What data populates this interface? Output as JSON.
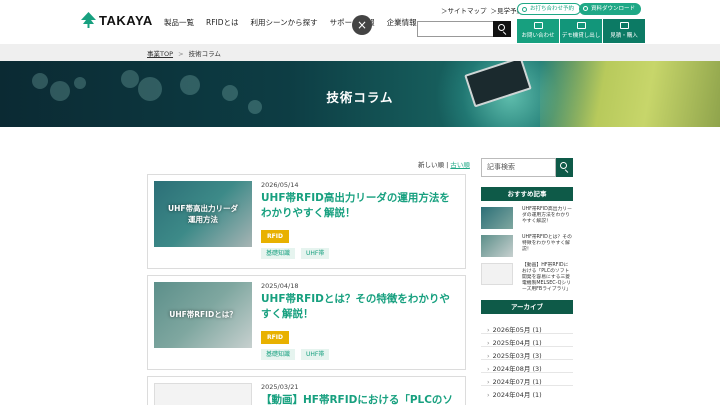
{
  "header": {
    "logo_text": "TAKAYA",
    "nav": [
      "製品一覧",
      "RFIDとは",
      "利用シーンから探す",
      "サポート情報",
      "企業情報"
    ],
    "close_symbol": "×",
    "utility_links": [
      "＞サイトマップ",
      "＞見学予約"
    ],
    "pill_contact": "お打ち合わせ予約",
    "pill_download": "資料ダウンロード",
    "search_placeholder": "",
    "cta": [
      "お問い合わせ",
      "デモ機貸し出し",
      "見積・購入"
    ]
  },
  "breadcrumb": {
    "home": "事業TOP",
    "separator": ">",
    "current": "技術コラム"
  },
  "hero": {
    "title": "技術コラム"
  },
  "sort": {
    "newest": "新しい順",
    "divider": "|",
    "oldest": "古い順"
  },
  "articles": [
    {
      "date": "2026/05/14",
      "title": "UHF帯RFID高出力リーダの運用方法をわかりやすく解説！",
      "thumb_text": "UHF帯高出力リーダ\n運用方法",
      "category": "RFID",
      "tags": [
        "基礎知識",
        "UHF帯"
      ]
    },
    {
      "date": "2025/04/18",
      "title": "UHF帯RFIDとは？その特徴をわかりやすく解説！",
      "thumb_text": "UHF帯RFIDとは？",
      "category": "RFID",
      "tags": [
        "基礎知識",
        "UHF帯"
      ]
    },
    {
      "date": "2025/03/21",
      "title": "【動画】HF帯RFIDにおける「PLCのソ",
      "thumb_text": "",
      "category": "",
      "tags": []
    }
  ],
  "sidebar": {
    "search_placeholder": "記事検索",
    "recommended_heading": "おすすめ記事",
    "recommended": [
      "UHF帯RFID高出力リーダの運用方法をわかりやすく解説！",
      "UHF帯RFIDとは？その特徴をわかりやすく解説！",
      "【動画】HF帯RFIDにおける「PLCのソフト開発を容易にする三菱電機製MELSEC-Qシリーズ用FBライブラリ」"
    ],
    "archive_heading": "アーカイブ",
    "archive": [
      "2026年05月 (1)",
      "2025年04月 (1)",
      "2025年03月 (3)",
      "2024年08月 (3)",
      "2024年07月 (1)",
      "2024年04月 (1)"
    ]
  },
  "colors": {
    "accent": "#17a07f",
    "dark_green": "#0e5a48",
    "category": "#e8b100"
  }
}
